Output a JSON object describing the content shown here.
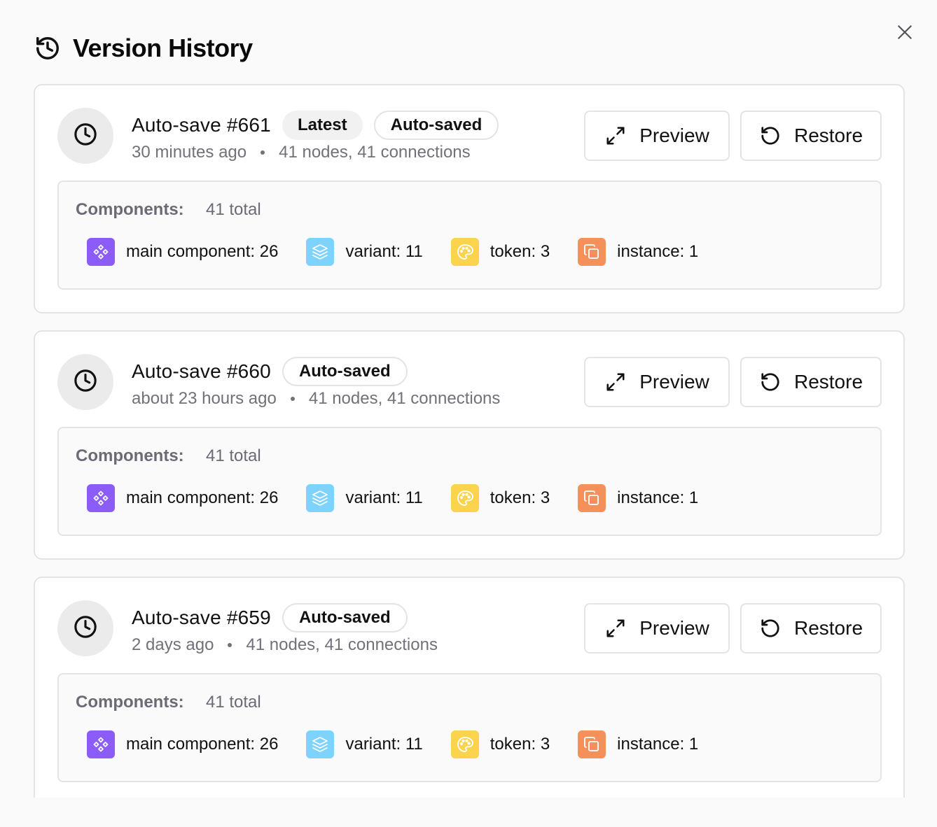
{
  "dialog": {
    "title": "Version History",
    "icons": {
      "title": "history-icon",
      "close": "close-icon"
    }
  },
  "versions": [
    {
      "title": "Auto-save #661",
      "badges": [
        "Latest",
        "Auto-saved"
      ],
      "time": "30 minutes ago",
      "stats": "41 nodes, 41 connections",
      "preview_label": "Preview",
      "restore_label": "Restore",
      "components_label": "Components:",
      "components_total": "41 total",
      "items": [
        "main component: 26",
        "variant: 11",
        "token: 3",
        "instance: 1"
      ]
    },
    {
      "title": "Auto-save #660",
      "badges": [
        "Auto-saved"
      ],
      "time": "about 23 hours ago",
      "stats": "41 nodes, 41 connections",
      "preview_label": "Preview",
      "restore_label": "Restore",
      "components_label": "Components:",
      "components_total": "41 total",
      "items": [
        "main component: 26",
        "variant: 11",
        "token: 3",
        "instance: 1"
      ]
    },
    {
      "title": "Auto-save #659",
      "badges": [
        "Auto-saved"
      ],
      "time": "2 days ago",
      "stats": "41 nodes, 41 connections",
      "preview_label": "Preview",
      "restore_label": "Restore",
      "components_label": "Components:",
      "components_total": "41 total",
      "items": [
        "main component: 26",
        "variant: 11",
        "token: 3",
        "instance: 1"
      ]
    }
  ],
  "component_types": [
    {
      "icon": "component-icon",
      "color": "#8b5cf6"
    },
    {
      "icon": "layers-icon",
      "color": "#7dd3fc"
    },
    {
      "icon": "palette-icon",
      "color": "#fcd34d"
    },
    {
      "icon": "copy-icon",
      "color": "#f4915a"
    }
  ]
}
